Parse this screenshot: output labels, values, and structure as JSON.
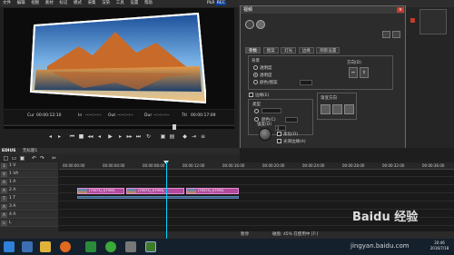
{
  "player": {
    "menu": [
      "文件",
      "编辑",
      "视图",
      "素材",
      "标记",
      "模式",
      "采集",
      "渲染",
      "工具",
      "设置",
      "帮助"
    ],
    "plr_label": "PLR",
    "rec_label": "REC",
    "timecodes": {
      "cur_label": "Cur",
      "cur": "00:00:12:10",
      "in_label": "In",
      "in": "--:--:--:--",
      "out_label": "Out",
      "out": "--:--:--:--",
      "dur_label": "Dur",
      "dur": "--:--:--:--",
      "ttl_label": "Ttl",
      "ttl": "00:00:17:09"
    }
  },
  "dialog": {
    "title": "视频",
    "close": "×",
    "tabs": [
      "参数",
      "图案",
      "灯光",
      "边缘",
      "阴影设置"
    ],
    "background_group": "背景",
    "radios": [
      {
        "label": "透明度",
        "selected": false
      },
      {
        "label": "透明度",
        "selected": true
      },
      {
        "label": "颜色/图案",
        "selected": false
      }
    ],
    "direction_label": "方向(D)",
    "edge_label": "边缘(E)",
    "edge_sub": [
      "类型",
      "颜色(C)"
    ],
    "gradient_label": "渐变方向",
    "density_label": "强度(D)",
    "size_value": "2",
    "checkbox_a": "柔化(O)",
    "checkbox_b": "光滑边缘(A)",
    "softness_label": "不透明度(M)",
    "softness_value": "100.00 %",
    "mini_tc": [
      "00:00:00:00",
      "00:00:01:00"
    ],
    "mini_row": "Cur 00:00:00:07   Ttl 00:00:01:07",
    "ok": "确定",
    "cancel": "取消"
  },
  "timeline": {
    "brand": "EDIUS",
    "project": "无标题1",
    "ruler_ticks": [
      "00:00:00:00",
      "00:00:04:00",
      "00:00:08:00",
      "00:00:12:00",
      "00:00:16:00",
      "00:00:20:00",
      "00:00:24:00",
      "00:00:28:00",
      "00:00:32:00",
      "00:00:36:00"
    ],
    "tracks": [
      {
        "tag": "1",
        "label": "1 V"
      },
      {
        "tag": "V",
        "label": "1 VA"
      },
      {
        "tag": "A",
        "label": "1 A"
      },
      {
        "tag": "A",
        "label": "2 A"
      },
      {
        "tag": "T",
        "label": "1 T"
      },
      {
        "tag": "A",
        "label": "3 A"
      },
      {
        "tag": "A",
        "label": "4 A"
      },
      {
        "tag": "L",
        "label": "L"
      }
    ],
    "clips": [
      {
        "label": "(79573)_f(7993)",
        "kind": "video"
      },
      {
        "label": "(79573)_f(7993)",
        "kind": "video"
      },
      {
        "label": "(79573)_f(7993)",
        "kind": "video"
      }
    ]
  },
  "status": {
    "left": "",
    "mode": "暂停",
    "right": "磁盘: 45% 在使用中 [F:]"
  },
  "taskbar": {
    "time": "20:46",
    "date": "2016/7/18"
  },
  "watermark": {
    "logo": "Baidu 经验",
    "url": "jingyan.baidu.com"
  },
  "colors": {
    "clip": "#b14a9c",
    "playhead": "#00d2ff",
    "rec": "#0c3e9c"
  }
}
